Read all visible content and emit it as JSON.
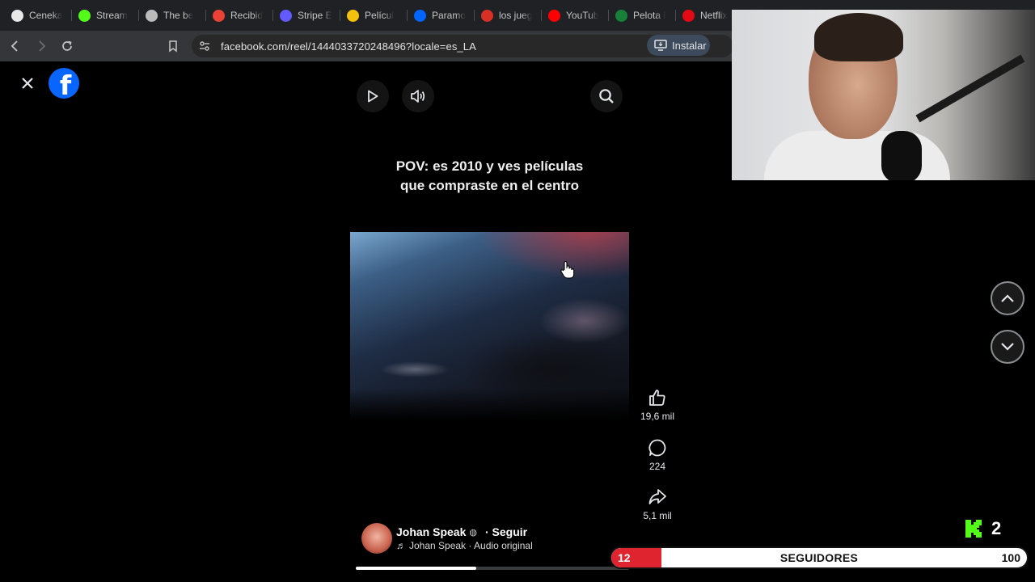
{
  "browser": {
    "tabs": [
      {
        "label": "Ceneka",
        "icon": "ceneka-icon",
        "color": "#e8e8e8"
      },
      {
        "label": "Stream",
        "icon": "kick-icon",
        "color": "#53fc18"
      },
      {
        "label": "The be",
        "icon": "notion-icon",
        "color": "#bbbbbb"
      },
      {
        "label": "Recibid",
        "icon": "gmail-icon",
        "color": "#ea4335"
      },
      {
        "label": "Stripe E",
        "icon": "stripe-icon",
        "color": "#635bff"
      },
      {
        "label": "Películ",
        "icon": "movie-icon",
        "color": "#f4c20d"
      },
      {
        "label": "Paramo",
        "icon": "paramount-icon",
        "color": "#0064ff"
      },
      {
        "label": "los jueg",
        "icon": "target-icon",
        "color": "#d93025"
      },
      {
        "label": "YouTub",
        "icon": "youtube-icon",
        "color": "#ff0000"
      },
      {
        "label": "Pelota l",
        "icon": "sheets-icon",
        "color": "#188038"
      },
      {
        "label": "Netflix",
        "icon": "netflix-icon",
        "color": "#e50914"
      }
    ],
    "url": "facebook.com/reel/1444033720248496?locale=es_LA",
    "install_label": "Instalar"
  },
  "reel": {
    "caption_line1": "POV: es 2010 y ves películas",
    "caption_line2": "que compraste en el centro",
    "likes": "19,6 mil",
    "comments": "224",
    "shares": "5,1 mil",
    "author": "Johan Speak",
    "follow_label": "· Seguir",
    "audio": "Johan Speak · Audio original",
    "progress_fraction": 0.44
  },
  "overlay": {
    "goal_label": "SEGUIDORES",
    "goal_current": "12",
    "goal_max": "100",
    "goal_fraction": 0.12,
    "kick_count": "2"
  },
  "colors": {
    "facebook_blue": "#0866ff",
    "goal_red": "#e0242f",
    "kick_green": "#53fc18"
  }
}
